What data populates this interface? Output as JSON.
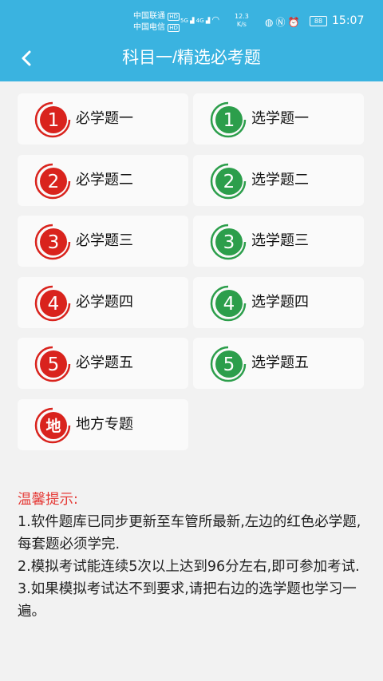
{
  "status_bar": {
    "carrier1": "中国联通",
    "carrier1_tag": "HD",
    "carrier2": "中国电信",
    "carrier2_tag": "HD",
    "network1": "5G",
    "network2": "4G",
    "speed_value": "12.3",
    "speed_unit": "K/s",
    "battery": "88",
    "time": "15:07"
  },
  "header": {
    "title": "科目一/精选必考题",
    "back_icon": "chevron-left-icon",
    "color": "#3ab3e0"
  },
  "colors": {
    "required": "#d9231d",
    "optional": "#2c9e4b",
    "tip_title": "#e53935"
  },
  "required_items": [
    {
      "num": "1",
      "label": "必学题一"
    },
    {
      "num": "2",
      "label": "必学题二"
    },
    {
      "num": "3",
      "label": "必学题三"
    },
    {
      "num": "4",
      "label": "必学题四"
    },
    {
      "num": "5",
      "label": "必学题五"
    }
  ],
  "optional_items": [
    {
      "num": "1",
      "label": "选学题一"
    },
    {
      "num": "2",
      "label": "选学题二"
    },
    {
      "num": "3",
      "label": "选学题三"
    },
    {
      "num": "4",
      "label": "选学题四"
    },
    {
      "num": "5",
      "label": "选学题五"
    }
  ],
  "local_item": {
    "num": "地",
    "label": "地方专题"
  },
  "tips": {
    "title": "温馨提示:",
    "lines": [
      "1.软件题库已同步更新至车管所最新,左边的红色必学题,每套题必须学完.",
      "2.模拟考试能连续5次以上达到96分左右,即可参加考试.",
      "3.如果模拟考试达不到要求,请把右边的选学题也学习一遍。"
    ]
  }
}
